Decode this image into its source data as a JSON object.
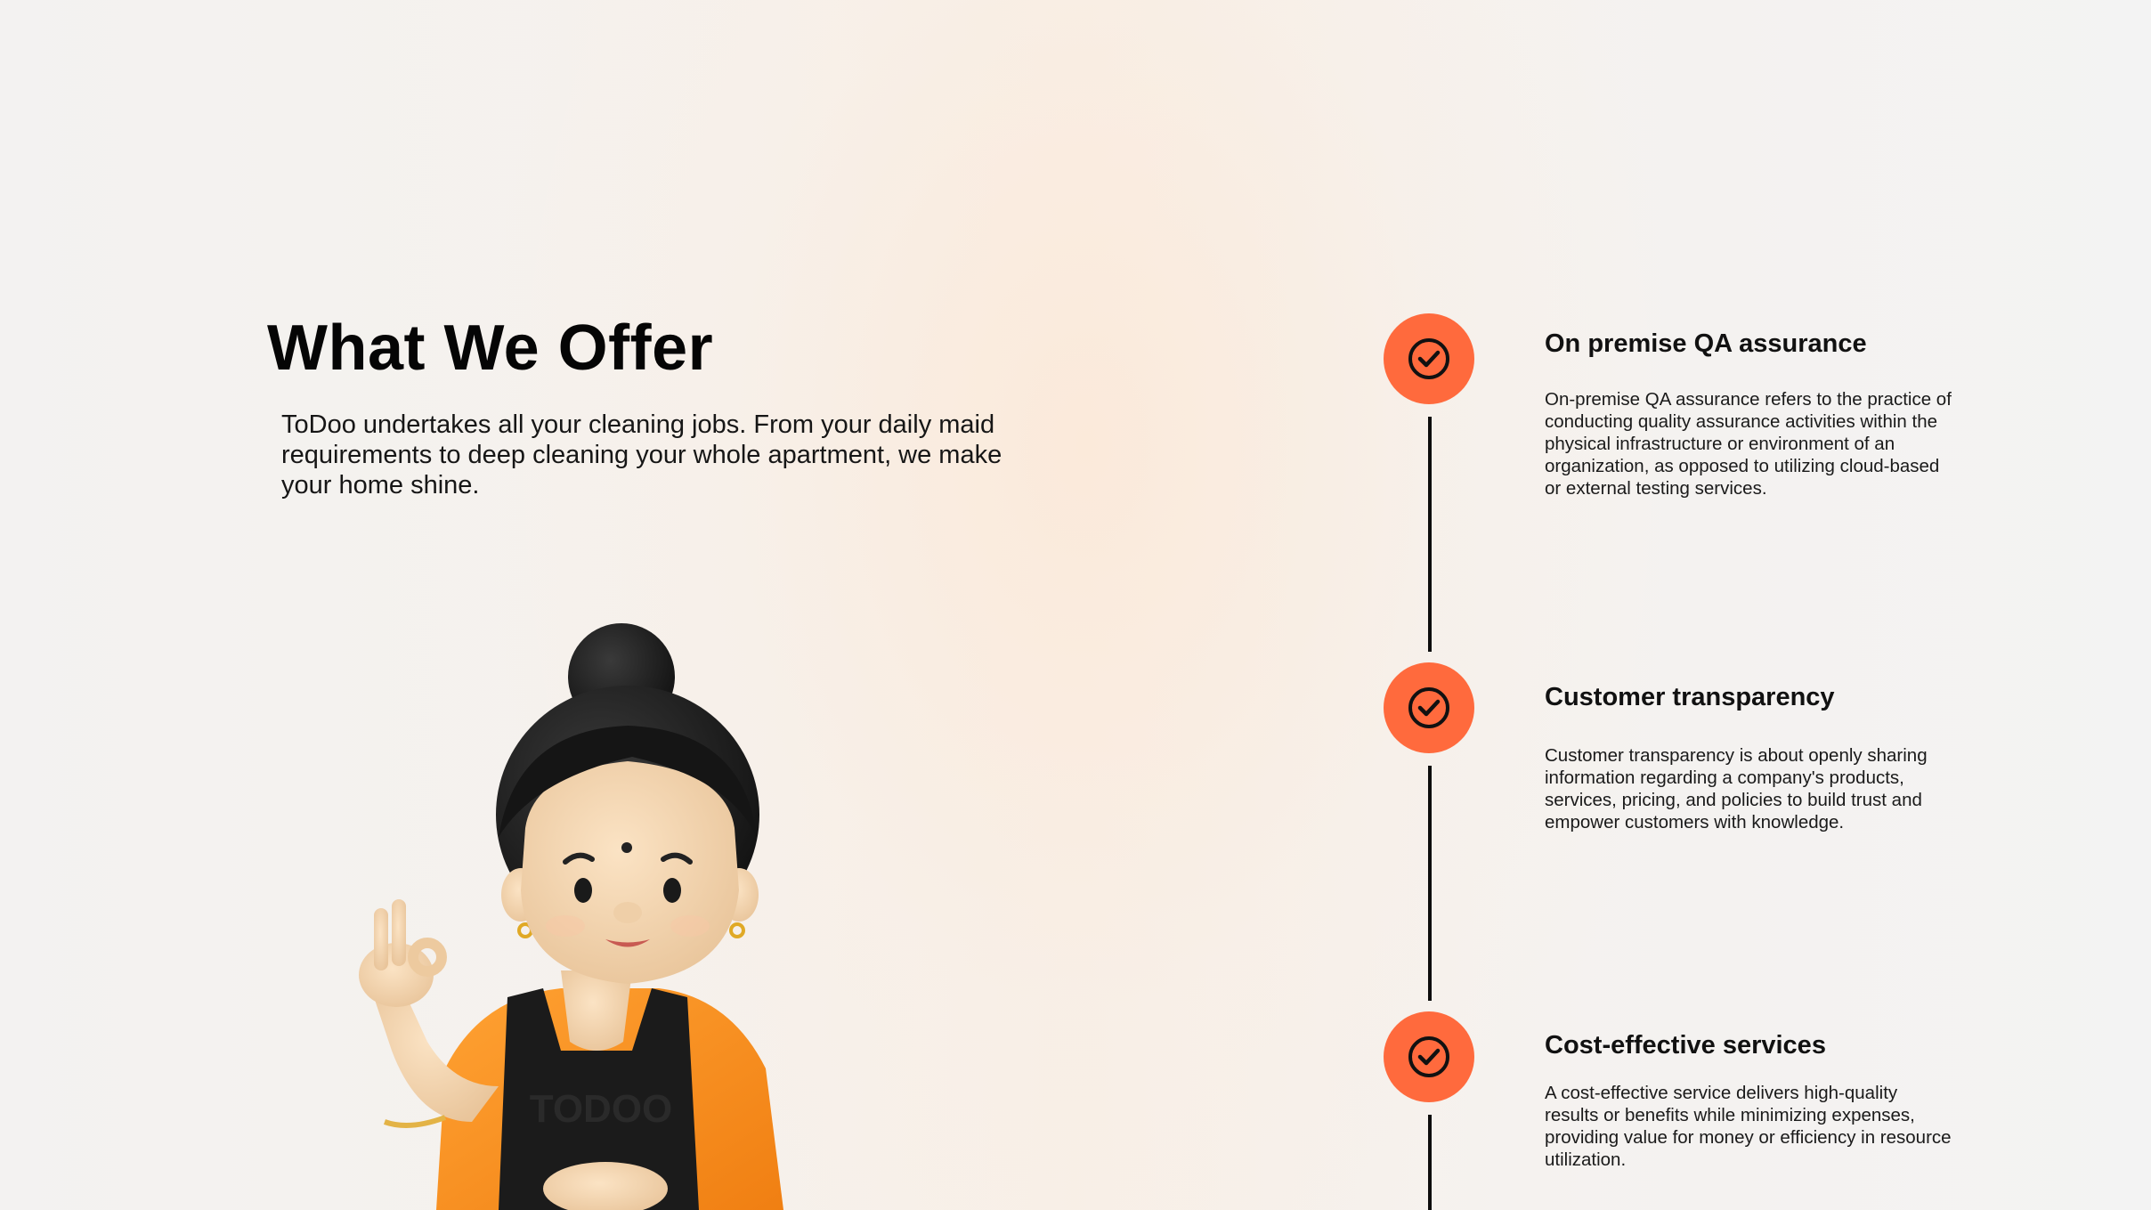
{
  "hero": {
    "title": "What We Offer",
    "description": "ToDoo undertakes all your cleaning jobs. From your daily maid requirements to deep cleaning your whole apartment, we make your home shine."
  },
  "illustration": {
    "icon": "maid-character-illustration",
    "apron_text": "TODOO"
  },
  "offers": [
    {
      "icon": "check-circle-icon",
      "title": "On premise QA assurance",
      "description": "On-premise QA assurance refers to the practice of conducting quality assurance activities within the physical infrastructure or environment of an organization, as opposed to utilizing cloud-based or external testing services."
    },
    {
      "icon": "check-circle-icon",
      "title": "Customer transparency",
      "description": "Customer transparency is about openly sharing information regarding a company's products, services, pricing, and policies to build trust and empower customers with knowledge."
    },
    {
      "icon": "check-circle-icon",
      "title": "Cost-effective services",
      "description": "A cost-effective service delivers high-quality results or benefits while minimizing expenses, providing value for money or efficiency in resource utilization."
    }
  ],
  "colors": {
    "accent": "#ff6a3d",
    "text": "#111111",
    "line": "#0d0d0d"
  }
}
